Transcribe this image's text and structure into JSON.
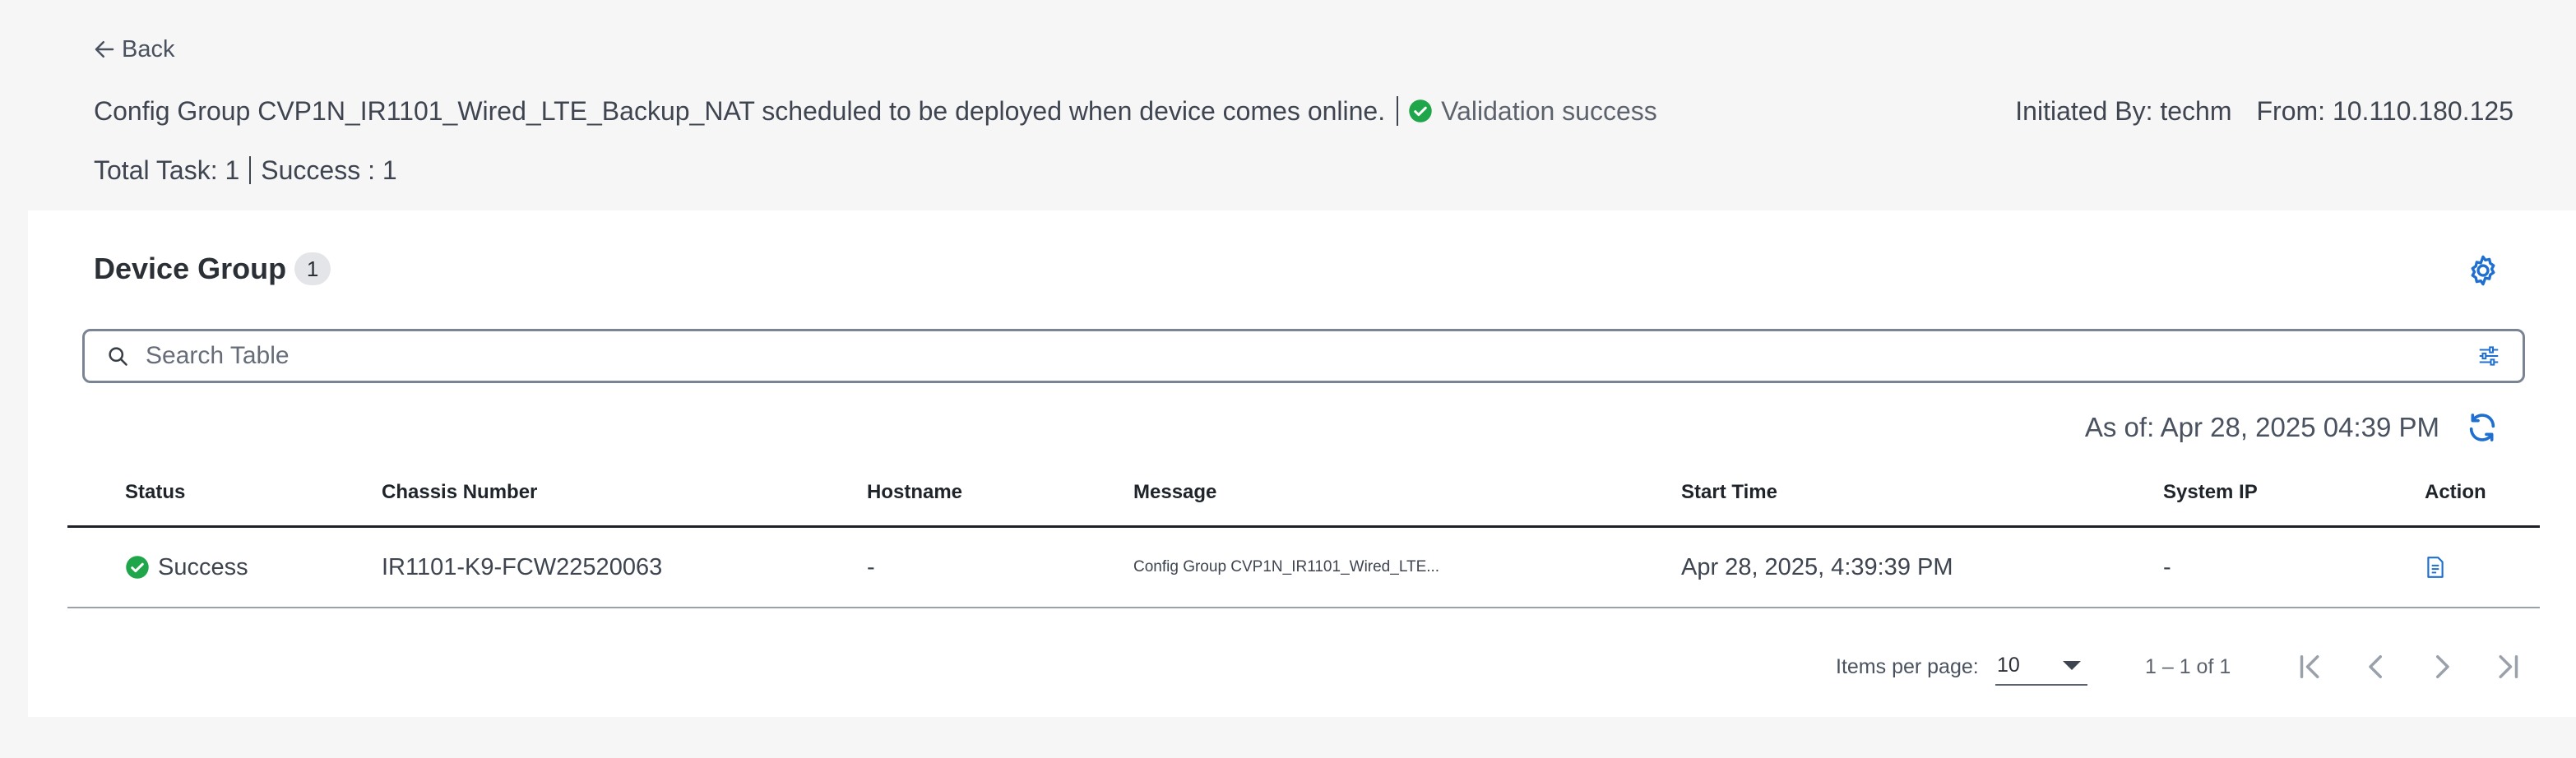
{
  "header": {
    "back_label": "Back",
    "message": "Config Group CVP1N_IR1101_Wired_LTE_Backup_NAT scheduled to be deployed when device comes online.",
    "validation": "Validation success",
    "initiated_by": "Initiated By: techm",
    "from": "From: 10.110.180.125",
    "total_task": "Total Task: 1",
    "success_count": "Success : 1"
  },
  "card": {
    "title": "Device Group",
    "count": "1",
    "search_placeholder": "Search Table",
    "as_of": "As of: Apr 28, 2025 04:39 PM"
  },
  "table": {
    "columns": [
      "Status",
      "Chassis Number",
      "Hostname",
      "Message",
      "Start Time",
      "System IP",
      "Action"
    ],
    "rows": [
      {
        "status": "Success",
        "chassis": "IR1101-K9-FCW22520063",
        "hostname": "-",
        "message": "Config Group CVP1N_IR1101_Wired_LTE...",
        "start_time": "Apr 28, 2025, 4:39:39 PM",
        "system_ip": "-"
      }
    ]
  },
  "pagination": {
    "items_per_page_label": "Items per page:",
    "items_per_page": "10",
    "range": "1 – 1 of 1"
  },
  "colors": {
    "success": "#1fa64a",
    "accent": "#1f6fd1",
    "background": "#f6f6f6"
  }
}
